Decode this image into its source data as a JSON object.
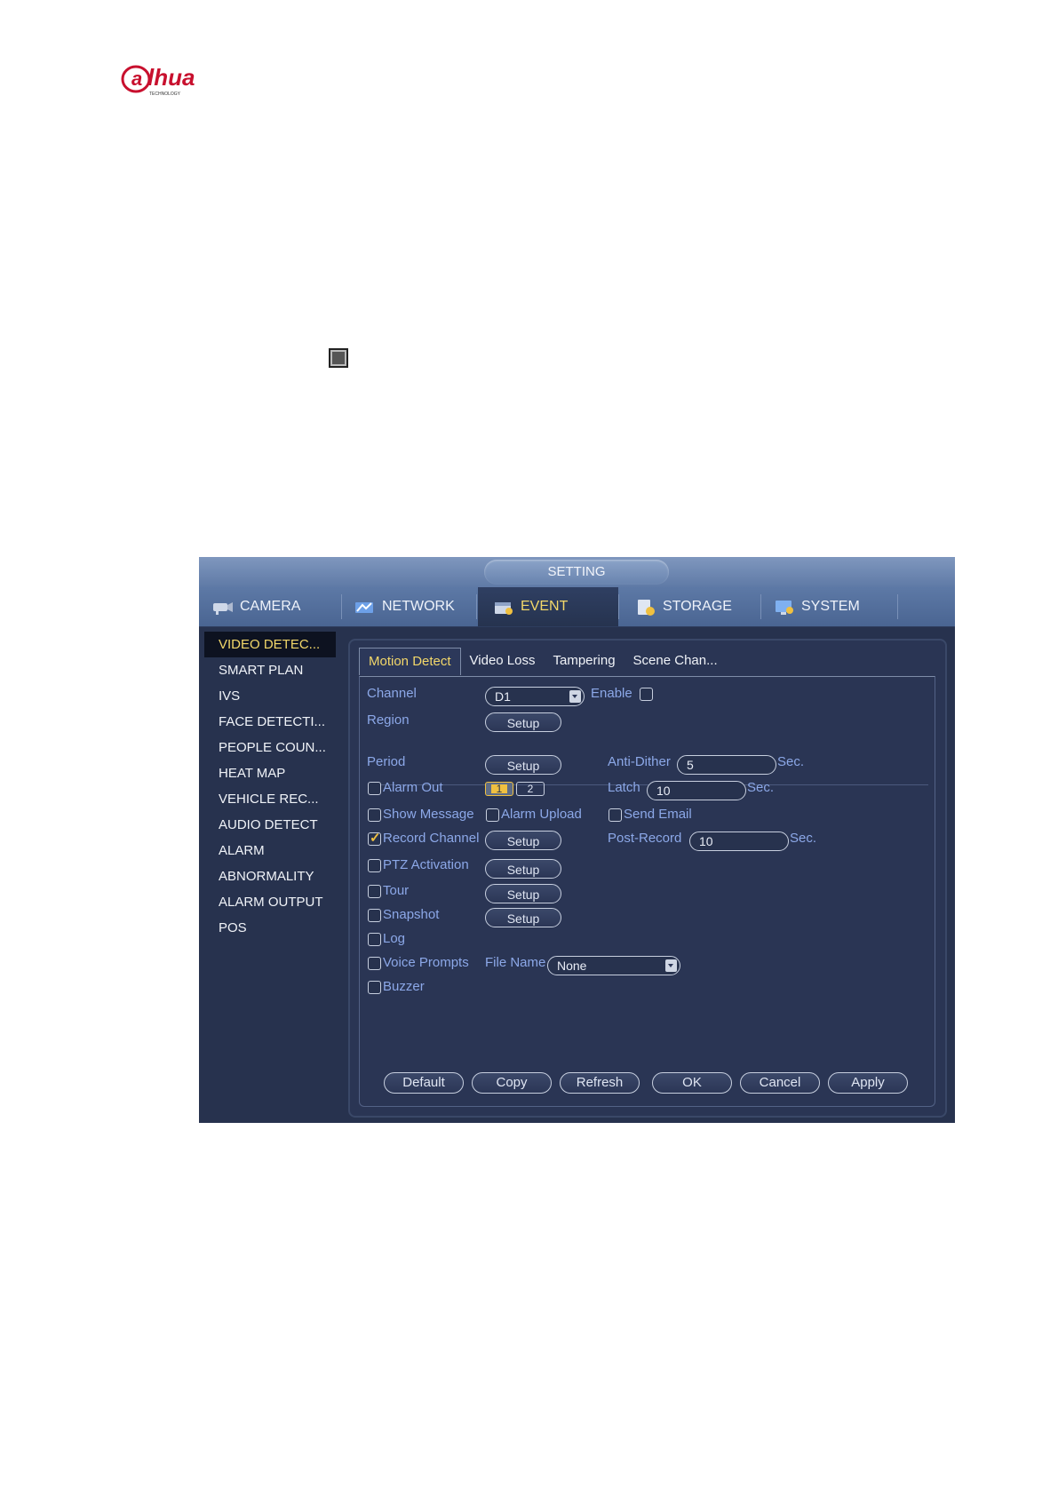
{
  "doc": {
    "logo_text": "alhua",
    "logo_subtext": "TECHNOLOGY"
  },
  "window": {
    "title": "SETTING"
  },
  "mainnav": {
    "tabs": [
      {
        "label": "CAMERA",
        "icon": "camera-icon"
      },
      {
        "label": "NETWORK",
        "icon": "network-icon"
      },
      {
        "label": "EVENT",
        "icon": "event-icon"
      },
      {
        "label": "STORAGE",
        "icon": "storage-icon"
      },
      {
        "label": "SYSTEM",
        "icon": "system-icon"
      }
    ],
    "active": "EVENT"
  },
  "leftmenu": {
    "items": [
      "VIDEO DETEC...",
      "SMART PLAN",
      "IVS",
      "FACE DETECTI...",
      "PEOPLE COUN...",
      "HEAT MAP",
      "VEHICLE REC...",
      "AUDIO DETECT",
      "ALARM",
      "ABNORMALITY",
      "ALARM OUTPUT",
      "POS"
    ],
    "active": "VIDEO DETEC..."
  },
  "subtabs": [
    "Motion Detect",
    "Video Loss",
    "Tampering",
    "Scene Chan..."
  ],
  "form": {
    "channel_label": "Channel",
    "channel_value": "D1",
    "enable_label": "Enable",
    "region_label": "Region",
    "setup_label": "Setup",
    "period_label": "Period",
    "anti_dither_label": "Anti-Dither",
    "anti_dither_value": "5",
    "sec_label": "Sec.",
    "alarm_out_label": "Alarm Out",
    "alarm_out_options": [
      "1",
      "2"
    ],
    "latch_label": "Latch",
    "latch_value": "10",
    "show_message_label": "Show Message",
    "alarm_upload_label": "Alarm Upload",
    "send_email_label": "Send Email",
    "record_channel_label": "Record Channel",
    "post_record_label": "Post-Record",
    "post_record_value": "10",
    "ptz_label": "PTZ Activation",
    "tour_label": "Tour",
    "snapshot_label": "Snapshot",
    "log_label": "Log",
    "voice_prompts_label": "Voice Prompts",
    "file_name_label": "File Name",
    "file_name_value": "None",
    "buzzer_label": "Buzzer"
  },
  "buttons": {
    "default": "Default",
    "copy": "Copy",
    "refresh": "Refresh",
    "ok": "OK",
    "cancel": "Cancel",
    "apply": "Apply"
  },
  "colors": {
    "accent_active": "#f3d86a",
    "label_blue": "#8ca8e8",
    "panel_bg": "#27324e",
    "logo_red": "#c8102e"
  }
}
